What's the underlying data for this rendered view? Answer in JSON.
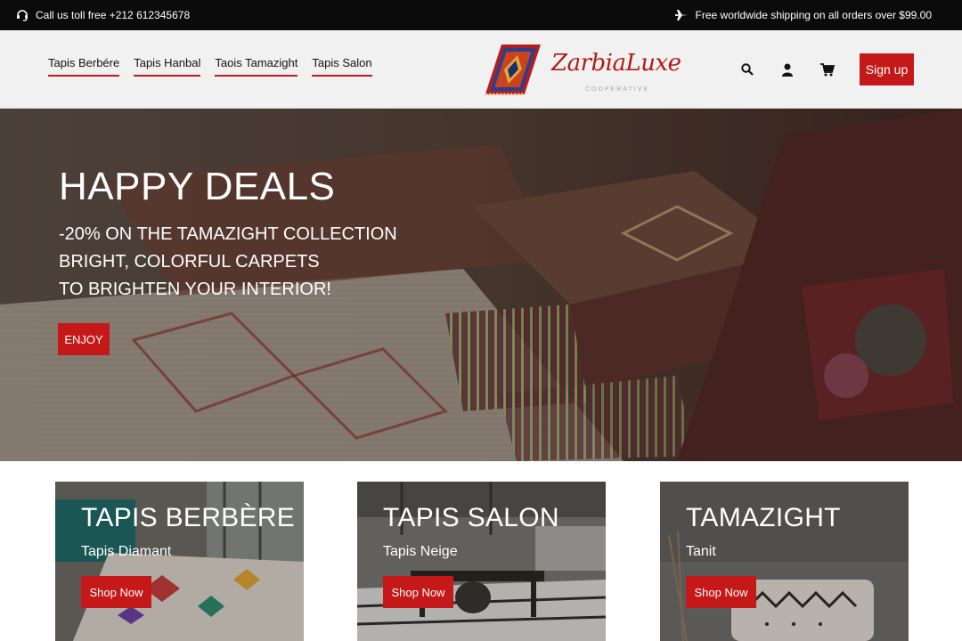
{
  "topbar": {
    "phone_text": "Call us toll free +212 612345678",
    "shipping_text": "Free worldwide shipping on all orders over $99.00",
    "phone_icon": "headset-icon",
    "shipping_icon": "plane-icon"
  },
  "header": {
    "nav": [
      "Tapis Berbére",
      "Tapis Hanbal",
      "Taois Tamazight",
      "Tapis Salon"
    ],
    "logo_text": "ZarbiaLuxe",
    "logo_sub": "COOPERATIVE",
    "icons": [
      "search-icon",
      "user-icon",
      "cart-icon"
    ],
    "signup_label": "Sign up"
  },
  "hero": {
    "title": "HAPPY DEALS",
    "lines": [
      "-20% ON THE TAMAZIGHT COLLECTION",
      "BRIGHT, COLORFUL CARPETS",
      "TO BRIGHTEN YOUR INTERIOR!"
    ],
    "cta": "ENJOY"
  },
  "cards": [
    {
      "title": "TAPIS BERBÈRE",
      "sub": "Tapis Diamant",
      "button": "Shop Now"
    },
    {
      "title": "TAPIS SALON",
      "sub": "Tapis Neige",
      "button": "Shop Now"
    },
    {
      "title": "TAMAZIGHT",
      "sub": "Tanit",
      "button": "Shop Now"
    }
  ],
  "colors": {
    "accent": "#c51919",
    "topbar": "#0b0b0b",
    "header_bg": "#f1f1f1"
  }
}
